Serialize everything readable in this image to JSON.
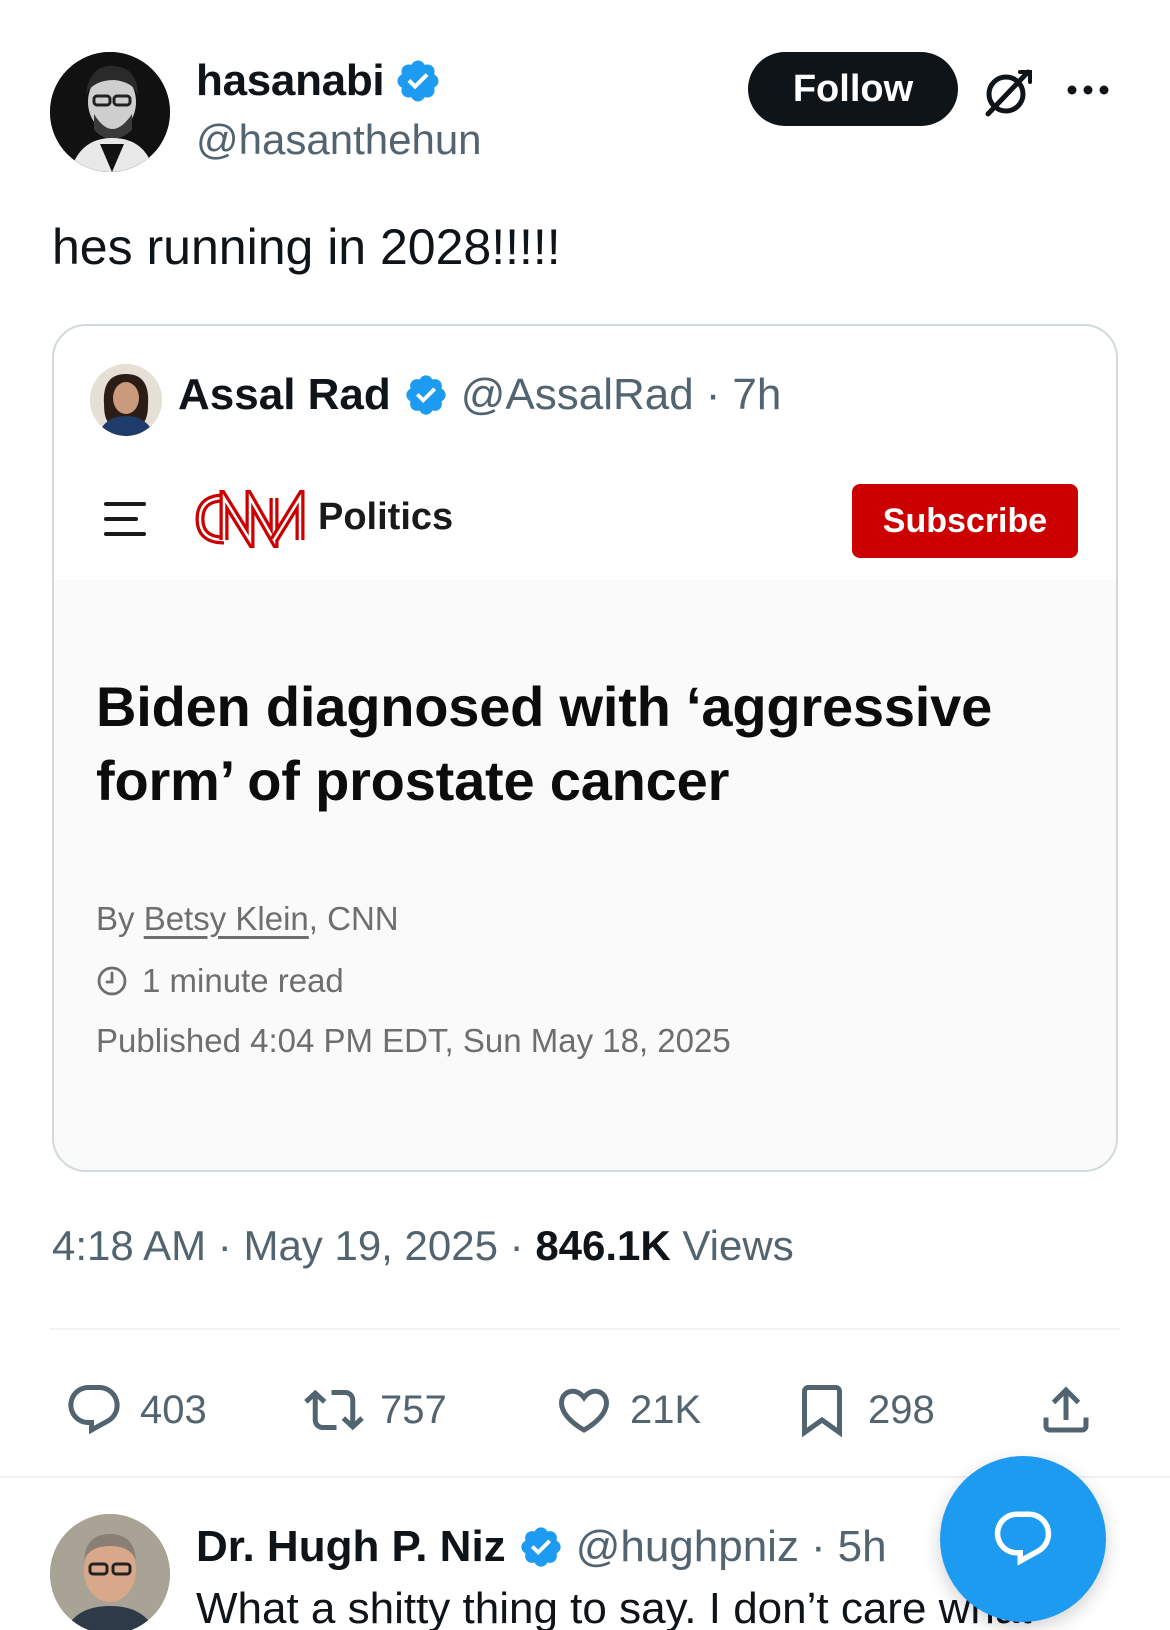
{
  "author": {
    "display_name": "hasanabi",
    "handle": "@hasanthehun"
  },
  "follow_label": "Follow",
  "tweet_text": "hes running in 2028!!!!!",
  "quoted": {
    "display_name": "Assal Rad",
    "handle": "@AssalRad",
    "separator": "·",
    "time": "7h",
    "cnn": {
      "section": "Politics",
      "subscribe_label": "Subscribe",
      "headline": "Biden diagnosed with ‘aggressive form’ of prostate cancer",
      "byline_prefix": "By ",
      "byline_author": "Betsy Klein",
      "byline_suffix": ", CNN",
      "read_time": "1 minute read",
      "published": "Published 4:04 PM EDT, Sun May 18, 2025"
    }
  },
  "meta": {
    "time": "4:18 AM",
    "date": "May 19, 2025",
    "separator": "·",
    "views_count": "846.1K",
    "views_label": "Views"
  },
  "actions": {
    "replies": "403",
    "retweets": "757",
    "likes": "21K",
    "bookmarks": "298"
  },
  "reply": {
    "display_name": "Dr. Hugh P. Niz",
    "handle": "@hughpniz",
    "separator": "·",
    "time": "5h",
    "text": "What a shitty thing to say. I don’t care what"
  },
  "colors": {
    "verified_blue": "#1d9bf0",
    "cnn_red": "#cc0000",
    "muted_text": "#536471"
  },
  "icons": [
    "verified-badge-icon",
    "grok-icon",
    "more-icon",
    "menu-icon",
    "clock-icon",
    "reply-icon",
    "retweet-icon",
    "like-icon",
    "bookmark-icon",
    "share-icon",
    "compose-reply-icon"
  ]
}
